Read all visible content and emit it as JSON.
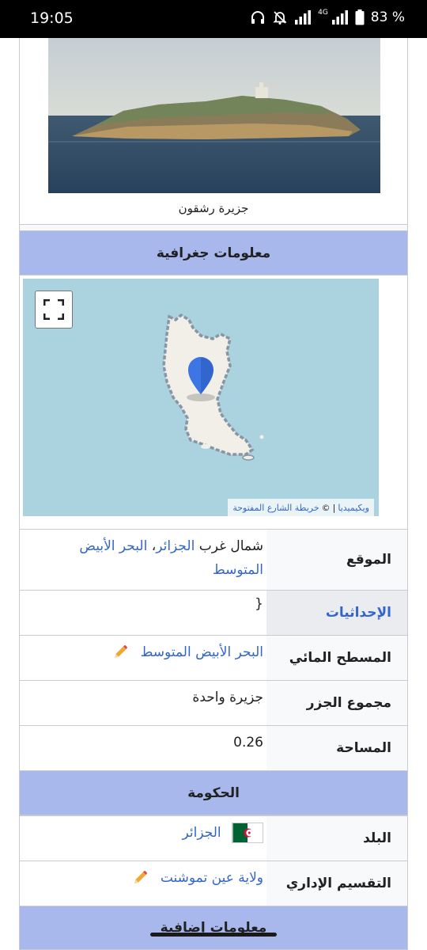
{
  "status_bar": {
    "time": "19:05",
    "network_label": "4G",
    "battery": "83 %",
    "icons": [
      "headphones-icon",
      "bell-muted-icon",
      "signal-icon",
      "signal-4g-icon",
      "battery-icon"
    ]
  },
  "infobox": {
    "image_caption": "جزيرة رشقون",
    "geo_header": "معلومات جغرافية",
    "map": {
      "attribution_wiki": "ويكيميديا",
      "attribution_sep": "|",
      "attribution_copy": "©",
      "attribution_osm": "خريطة الشارع المفتوحة"
    },
    "rows": {
      "location": {
        "label": "الموقع",
        "prefix": "شمال غرب ",
        "link1": "الجزائر",
        "sep": "، ",
        "link2": "البحر الأبيض المتوسط"
      },
      "coordinates": {
        "label": "الإحداثيات",
        "value": "{"
      },
      "water_body": {
        "label": "المسطح المائي",
        "value": "البحر الأبيض المتوسط"
      },
      "archipelago": {
        "label": "مجموع الجزر",
        "value": "جزيرة واحدة"
      },
      "area": {
        "label": "المساحة",
        "value": "0.26"
      }
    },
    "gov_header": "الحكومة",
    "gov_rows": {
      "country": {
        "label": "البلد",
        "value": "الجزائر"
      },
      "admin_division": {
        "label": "التقسيم الإداري",
        "value": "ولاية عين تموشنت"
      }
    },
    "extra_header": "معلومات إضافية"
  },
  "colors": {
    "header_bg": "#a8b8ec",
    "link": "#3366cc",
    "map_water": "#aad3df",
    "marker": "#3366cc"
  }
}
